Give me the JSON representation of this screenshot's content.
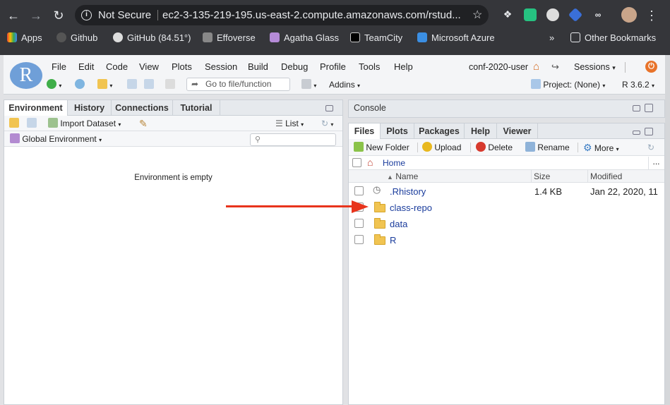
{
  "browser": {
    "security_label": "Not Secure",
    "url": "ec2-3-135-219-195.us-east-2.compute.amazonaws.com/rstud...",
    "bookmarks": [
      "Apps",
      "Github",
      "GitHub (84.51°)",
      "Effoverse",
      "Agatha Glass",
      "TeamCity",
      "Microsoft Azure"
    ],
    "overflow": "»",
    "other_bookmarks": "Other Bookmarks"
  },
  "rstudio": {
    "logo_letter": "R",
    "menu": [
      "File",
      "Edit",
      "Code",
      "View",
      "Plots",
      "Session",
      "Build",
      "Debug",
      "Profile",
      "Tools",
      "Help"
    ],
    "user": "conf-2020-user",
    "sessions": "Sessions",
    "goto_placeholder": "Go to file/function",
    "addins": "Addins",
    "project": "Project: (None)",
    "r_version": "R 3.6.2"
  },
  "env_pane": {
    "tabs": [
      "Environment",
      "History",
      "Connections",
      "Tutorial"
    ],
    "import_dataset": "Import Dataset",
    "list_view": "List",
    "global_env": "Global Environment",
    "empty_message": "Environment is empty"
  },
  "console_pane": {
    "title": "Console"
  },
  "files_pane": {
    "tabs": [
      "Files",
      "Plots",
      "Packages",
      "Help",
      "Viewer"
    ],
    "new_folder": "New Folder",
    "upload": "Upload",
    "delete": "Delete",
    "rename": "Rename",
    "more": "More",
    "breadcrumb": "Home",
    "breadcrumb_more": "...",
    "columns": {
      "name": "Name",
      "size": "Size",
      "modified": "Modified"
    },
    "files": [
      {
        "name": ".Rhistory",
        "type": "file",
        "size": "1.4 KB",
        "modified": "Jan 22, 2020, 11"
      },
      {
        "name": "class-repo",
        "type": "folder",
        "size": "",
        "modified": ""
      },
      {
        "name": "data",
        "type": "folder",
        "size": "",
        "modified": ""
      },
      {
        "name": "R",
        "type": "folder",
        "size": "",
        "modified": ""
      }
    ]
  },
  "colors": {
    "annotation_arrow": "#e8341c",
    "rstudio_blue": "#6f9fd8",
    "file_link": "#1a3c9c"
  }
}
